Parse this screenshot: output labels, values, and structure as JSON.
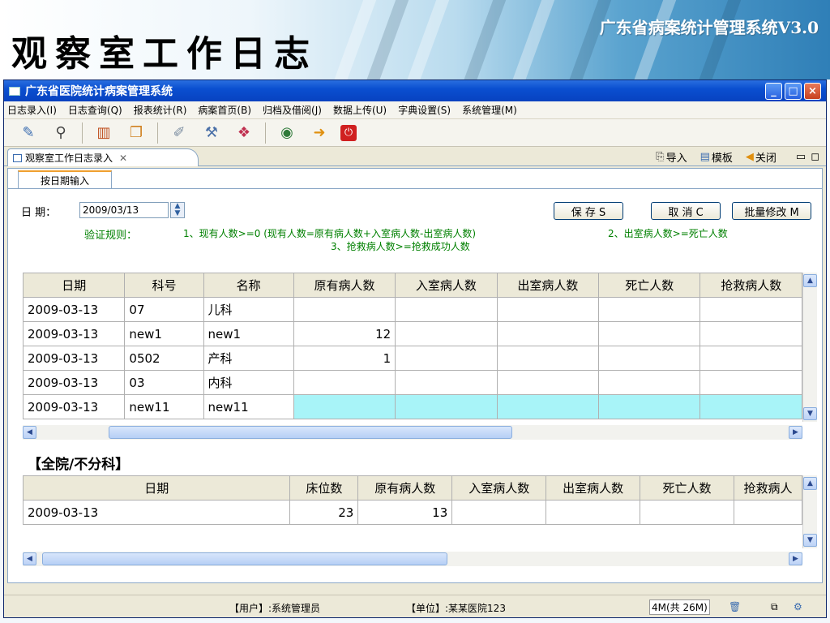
{
  "slide": {
    "title": "观察室工作日志",
    "subtitle": "广东省病案统计管理系统V3.0"
  },
  "window": {
    "title": "广东省医院统计病案管理系统",
    "controls": {
      "minimize": "_",
      "maximize": "□",
      "close": "×"
    }
  },
  "menu": {
    "items": [
      "日志录入(I)",
      "日志查询(Q)",
      "报表统计(R)",
      "病案首页(B)",
      "归档及借阅(J)",
      "数据上传(U)",
      "字典设置(S)",
      "系统管理(M)"
    ]
  },
  "toolbar": {
    "icons": [
      "edit-icon",
      "binoculars-icon",
      "bar-chart-icon",
      "copy-icon",
      "note-icon",
      "tools-icon",
      "book-icon",
      "globe-icon",
      "exit-icon",
      "power-icon"
    ]
  },
  "tab": {
    "label": "观察室工作日志录入",
    "close": "✕",
    "actions": {
      "import": "导入",
      "template": "模板",
      "close": "关闭"
    }
  },
  "subtab": {
    "label": "按日期输入"
  },
  "form": {
    "date_label": "日 期：",
    "date_value": "2009/03/13",
    "save": "保 存 S",
    "cancel": "取 消 C",
    "batch": "批量修改 M",
    "rules_label": "验证规则：",
    "rule1": "1、现有人数>=0 (现有人数=原有病人数+入室病人数-出室病人数)",
    "rule2": "2、出室病人数>=死亡人数",
    "rule3": "3、抢救病人数>=抢救成功人数"
  },
  "dept_table": {
    "columns": [
      "日期",
      "科号",
      "名称",
      "原有病人数",
      "入室病人数",
      "出室病人数",
      "死亡人数",
      "抢救病人数"
    ],
    "rows": [
      [
        "2009-03-13",
        "07",
        "儿科",
        "",
        "",
        "",
        "",
        ""
      ],
      [
        "2009-03-13",
        "new1",
        "new1",
        "12",
        "",
        "",
        "",
        ""
      ],
      [
        "2009-03-13",
        "0502",
        "产科",
        "1",
        "",
        "",
        "",
        ""
      ],
      [
        "2009-03-13",
        "03",
        "内科",
        "",
        "",
        "",
        "",
        ""
      ],
      [
        "2009-03-13",
        "new11",
        "new11",
        "",
        "",
        "",
        "",
        ""
      ]
    ],
    "selected_row": 4
  },
  "hospital_section": {
    "label": "【全院/不分科】"
  },
  "hospital_table": {
    "columns": [
      "日期",
      "床位数",
      "原有病人数",
      "入室病人数",
      "出室病人数",
      "死亡人数",
      "抢救病人"
    ],
    "rows": [
      [
        "2009-03-13",
        "23",
        "13",
        "",
        "",
        "",
        ""
      ]
    ]
  },
  "status": {
    "user": "【用户】:系统管理员",
    "unit": "【单位】:某某医院123",
    "memory": "4M(共 26M)"
  },
  "colors": {
    "selected_row": "#a8f4f8",
    "titlebar": "#0a4fd0",
    "rules_text": "#008000"
  }
}
